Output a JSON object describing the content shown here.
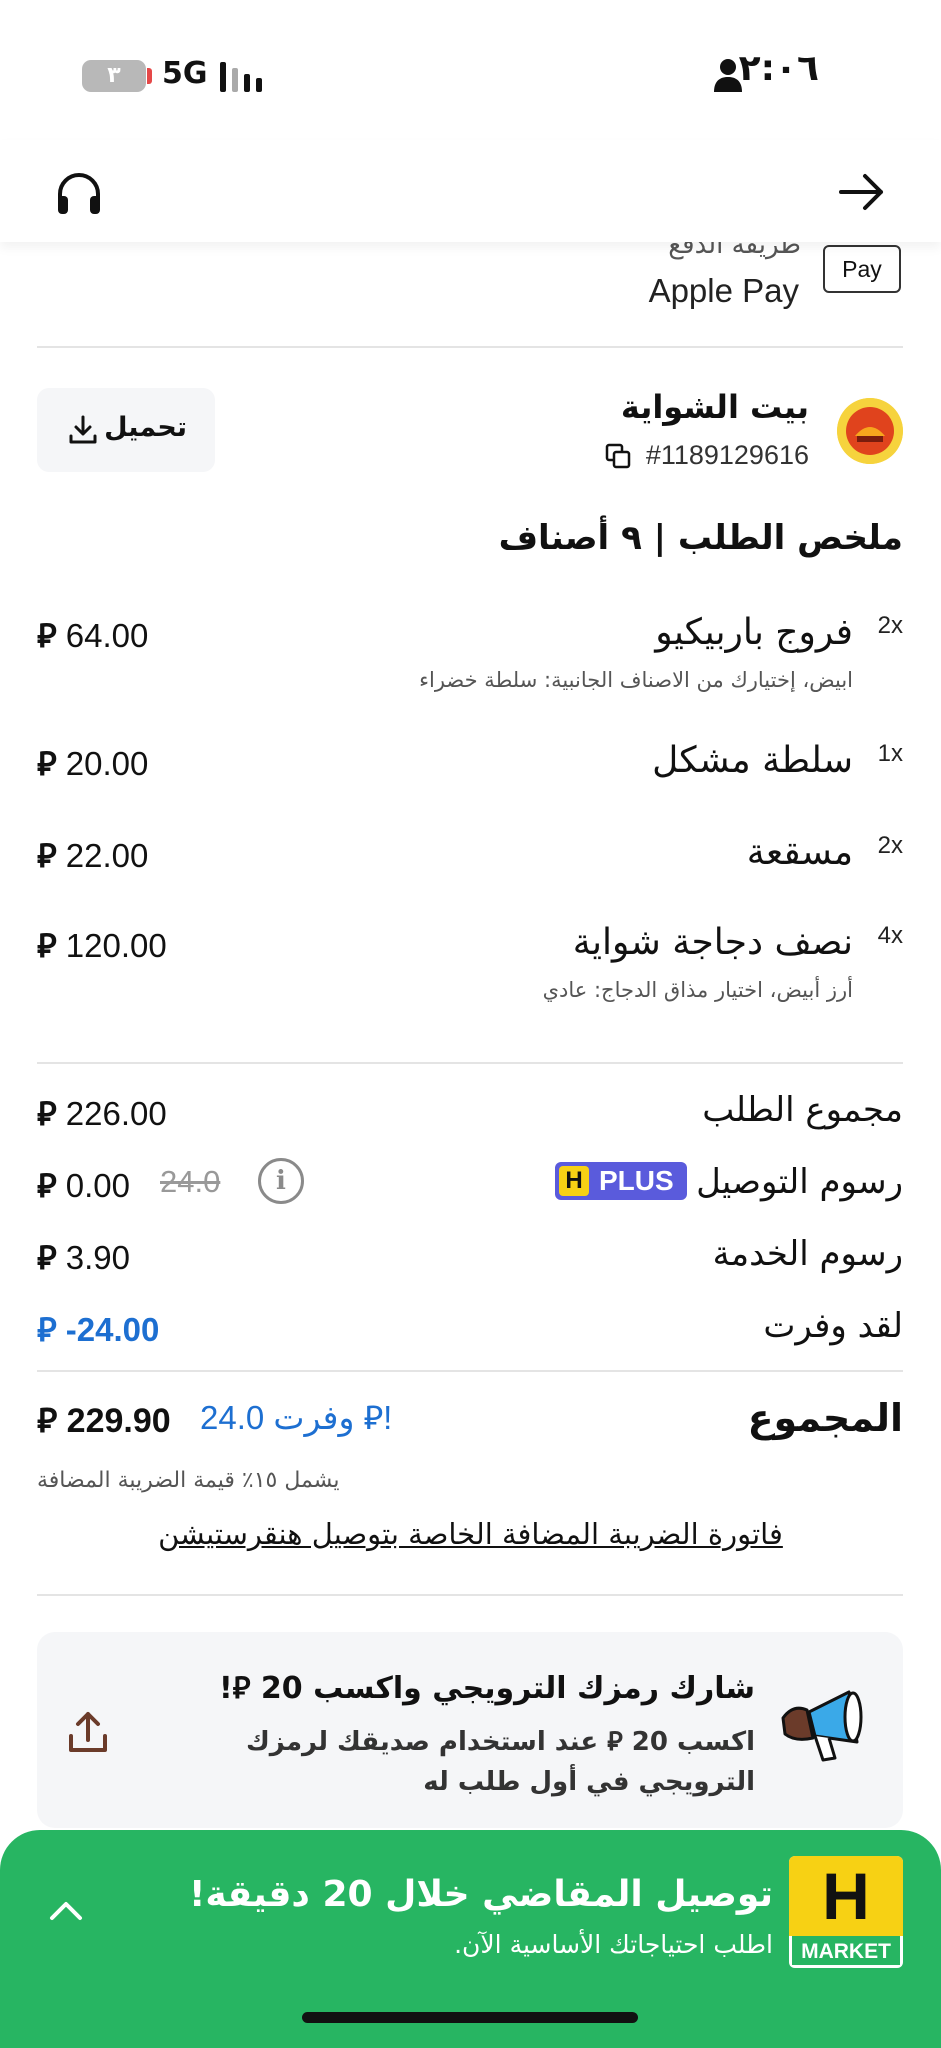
{
  "status_bar": {
    "time": "٢:٠٦",
    "network": "5G",
    "battery": "٣"
  },
  "payment": {
    "label": "طريقة الدفع",
    "value": "Apple Pay",
    "badge": " Pay"
  },
  "restaurant": {
    "name": "بيت الشواية",
    "order_id": "#1189129616"
  },
  "download_label": "تحميل",
  "summary_title": "ملخص الطلب | ٩ أصناف",
  "currency_symbol": "⃁",
  "items": [
    {
      "qty": "2x",
      "name": "فروج باربيكيو",
      "desc": "ابيض، إختيارك من الاصناف الجانبية: سلطة خضراء",
      "price": "64.00"
    },
    {
      "qty": "1x",
      "name": "سلطة مشكل",
      "desc": "",
      "price": "20.00"
    },
    {
      "qty": "2x",
      "name": "مسقعة",
      "desc": "",
      "price": "22.00"
    },
    {
      "qty": "4x",
      "name": "نصف دجاجة شواية",
      "desc": "أرز أبيض، اختيار مذاق الدجاج: عادي",
      "price": "120.00"
    }
  ],
  "totals": {
    "subtotal_label": "مجموع الطلب",
    "subtotal_value": "226.00",
    "delivery_label": "رسوم التوصيل",
    "plus_badge": "PLUS",
    "plus_badge_letter": "H",
    "delivery_old": "24.0",
    "delivery_value": "0.00",
    "service_label": "رسوم الخدمة",
    "service_value": "3.90",
    "saved_label": "لقد وفرت",
    "saved_value": "-24.00",
    "total_label": "المجموع",
    "total_value": "229.90",
    "saved_note": "وفرت 24.0 ⃁!",
    "vat_note": "يشمل ١٥٪ قيمة الضريبة المضافة",
    "invoice_link": "فاتورة الضريبة المضافة الخاصة بتوصيل هنقرستيشن"
  },
  "referral": {
    "title": "شارك رمزك الترويجي واكسب 20 ⃁!",
    "body": "اكسب 20 ⃁ عند استخدام صديقك لرمزك الترويجي في أول طلب له"
  },
  "banner": {
    "title": "توصيل المقاضي خلال 20 دقيقة!",
    "subtitle": "اطلب احتياجاتك الأساسية الآن.",
    "logo_letter": "H",
    "logo_text": "MARKET"
  },
  "colors": {
    "accent_blue": "#1d6fd1",
    "banner_green": "#27b562",
    "plus_purple": "#5a5bdc",
    "brand_yellow": "#f7d114"
  }
}
